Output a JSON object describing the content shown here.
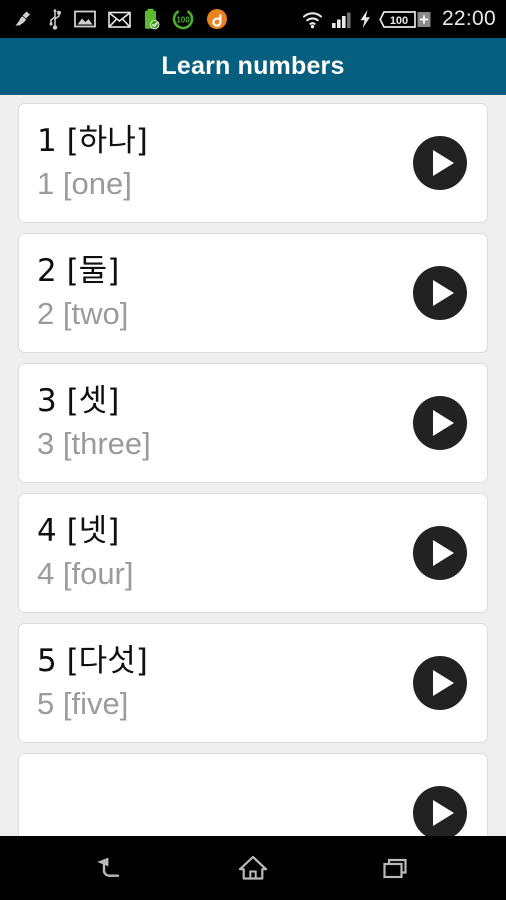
{
  "status_bar": {
    "time": "22:00",
    "battery_percent": "100",
    "battery_circle_label": "100",
    "icons": [
      "broom-cleaner-icon",
      "usb-icon",
      "photo-icon",
      "mail-icon",
      "battery-full-check-icon",
      "battery-percent-circle-icon",
      "app-update-icon",
      "wifi-icon",
      "cellular-signal-icon",
      "charging-bolt-icon",
      "battery-level-icon"
    ]
  },
  "title_bar": {
    "title": "Learn numbers"
  },
  "colors": {
    "title_bar_bg": "#065f7e",
    "page_bg": "#efefef",
    "card_bg": "#ffffff",
    "card_border": "#dcdcdc",
    "primary_text": "#0f0f0f",
    "secondary_text": "#9b9b9b",
    "play_button_bg": "#222222",
    "status_bar_bg": "#000000",
    "nav_bar_bg": "#000000"
  },
  "list": {
    "items": [
      {
        "primary": "1 [하나]",
        "secondary": "1 [one]",
        "play_label": "play-1"
      },
      {
        "primary": "2 [둘]",
        "secondary": "2 [two]",
        "play_label": "play-2"
      },
      {
        "primary": "3 [셋]",
        "secondary": "3 [three]",
        "play_label": "play-3"
      },
      {
        "primary": "4 [넷]",
        "secondary": "4 [four]",
        "play_label": "play-4"
      },
      {
        "primary": "5 [다섯]",
        "secondary": "5 [five]",
        "play_label": "play-5"
      },
      {
        "primary": "",
        "secondary": "",
        "play_label": "play-6"
      }
    ]
  },
  "nav_bar": {
    "buttons": [
      {
        "name": "back-button"
      },
      {
        "name": "home-button"
      },
      {
        "name": "recents-button"
      }
    ]
  }
}
